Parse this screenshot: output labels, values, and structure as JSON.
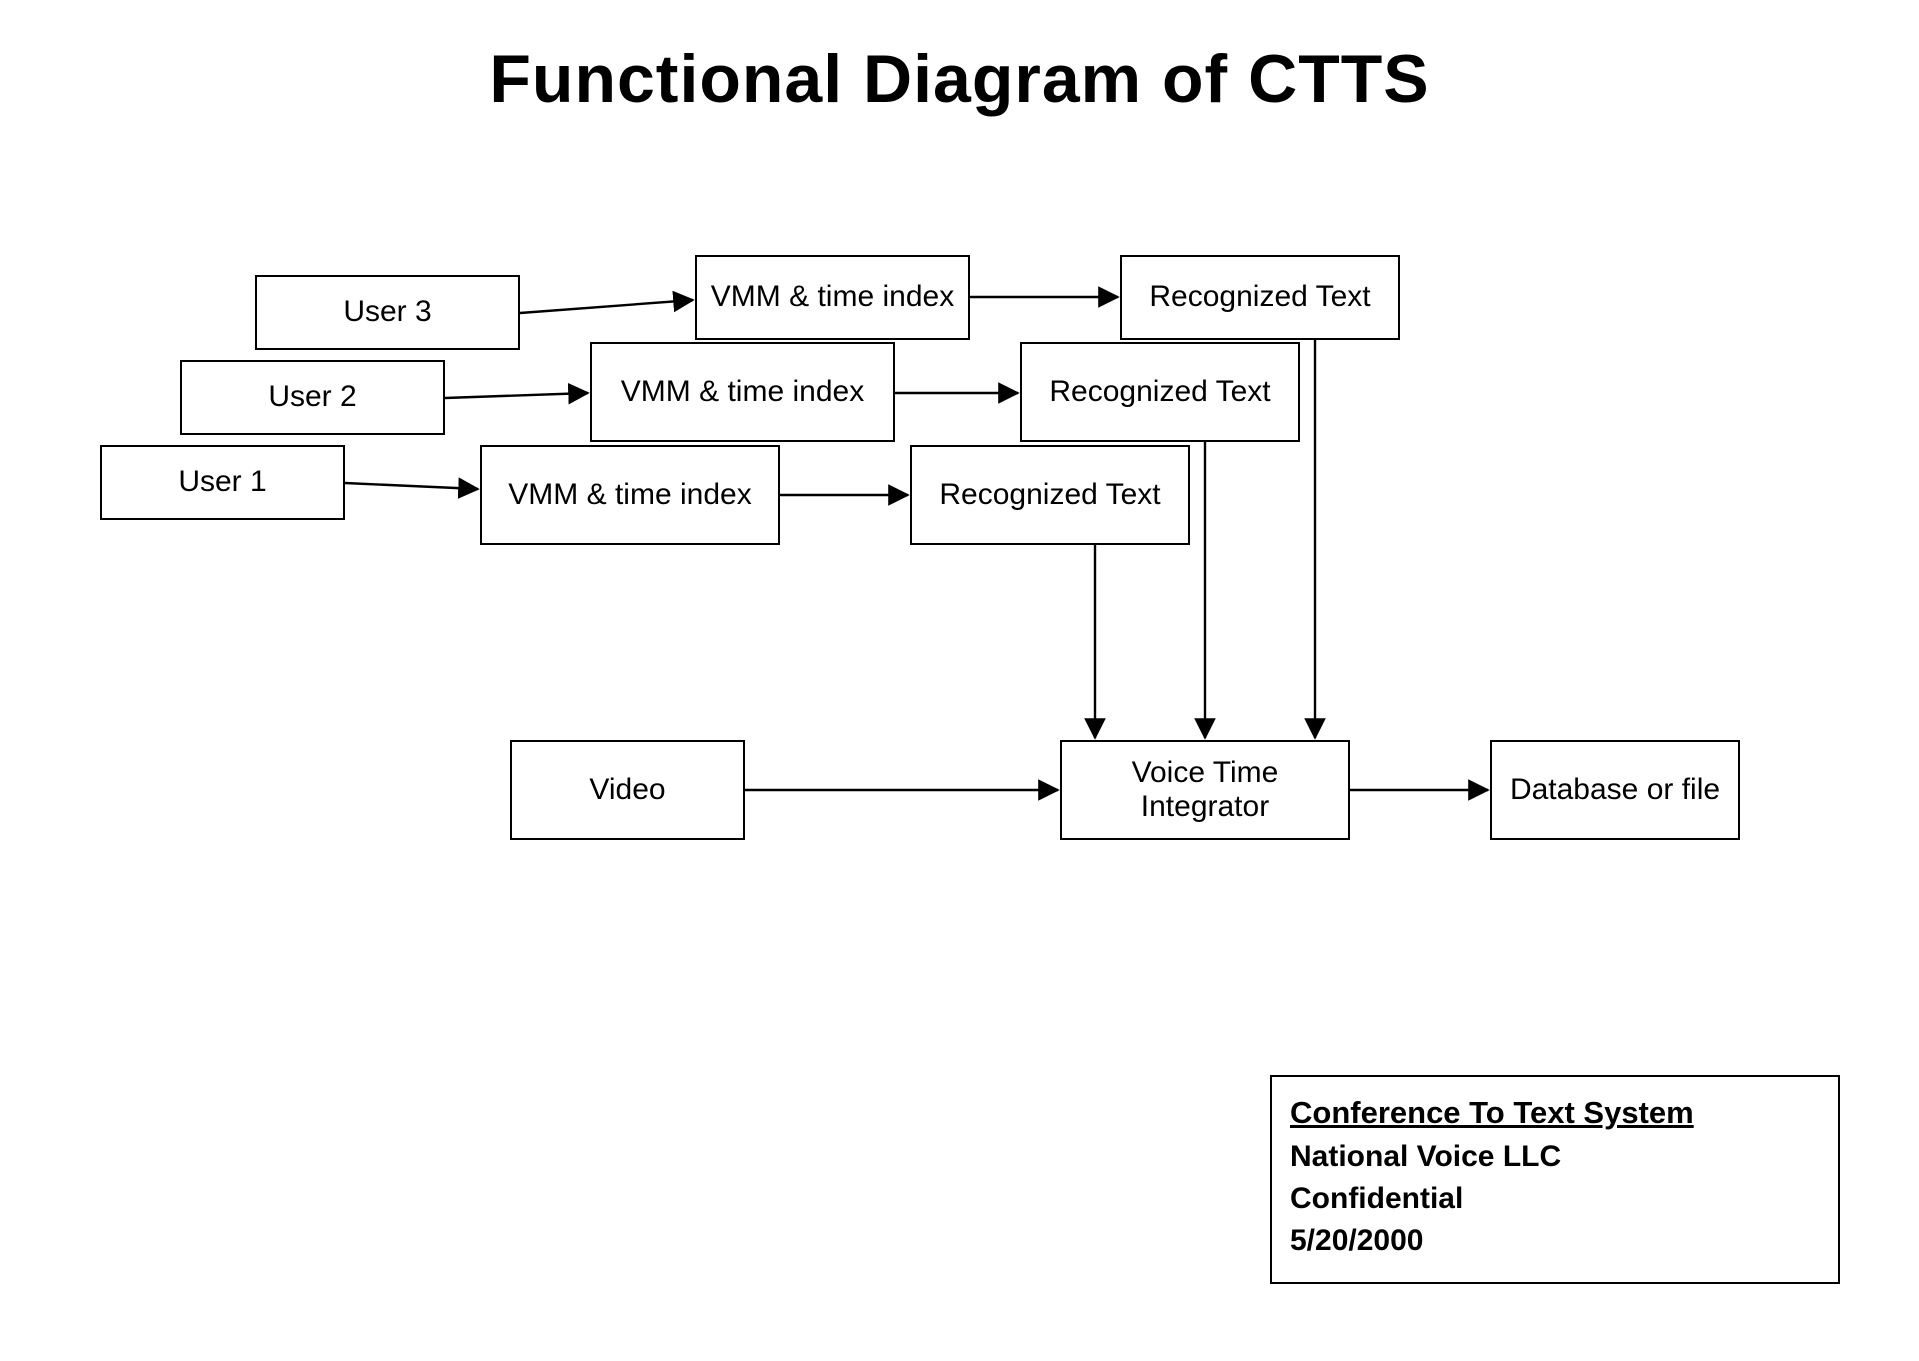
{
  "title": "Functional Diagram of CTTS",
  "nodes": {
    "user1": "User 1",
    "user2": "User 2",
    "user3": "User 3",
    "vmm1": "VMM & time index",
    "vmm2": "VMM & time index",
    "vmm3": "VMM & time index",
    "rec1": "Recognized Text",
    "rec2": "Recognized Text",
    "rec3": "Recognized Text",
    "video": "Video",
    "vti": "Voice Time Integrator",
    "db": "Database or file"
  },
  "legend": {
    "title": "Conference To Text System",
    "company": "National Voice LLC",
    "confidential": "Confidential",
    "date": "5/20/2000"
  }
}
